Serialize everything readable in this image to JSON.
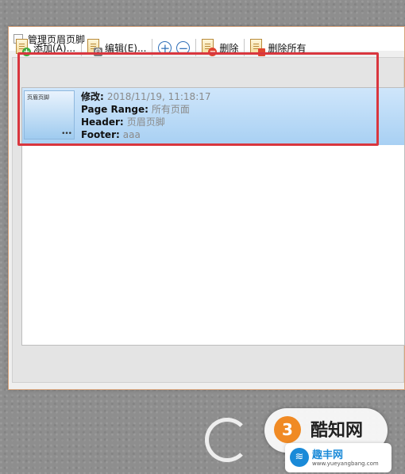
{
  "window": {
    "title": "管理页眉页脚"
  },
  "toolbar": {
    "add_label": "添加(A)...",
    "edit_label": "编辑(E)...",
    "plus_symbol": "+",
    "minus_symbol": "−",
    "delete_label": "删除",
    "delete_all_label": "删除所有"
  },
  "list": {
    "items": [
      {
        "thumb_label": "页眉页脚",
        "thumb_dots": "•••",
        "modified_key": "修改:",
        "modified_value": "2018/11/19, 11:18:17",
        "page_range_key": "Page Range:",
        "page_range_value": "所有页面",
        "header_key": "Header:",
        "header_value": "页眉页脚",
        "footer_key": "Footer:",
        "footer_value": "aaa"
      }
    ]
  },
  "watermark": {
    "circle_char": "3",
    "text": "酷知网",
    "banner_name": "趣丰网",
    "banner_url": "www.yueyangbang.com"
  },
  "colors": {
    "highlight": "#d9363e",
    "selection": "#a8d0f3",
    "accent_blue": "#2f6fb8"
  }
}
